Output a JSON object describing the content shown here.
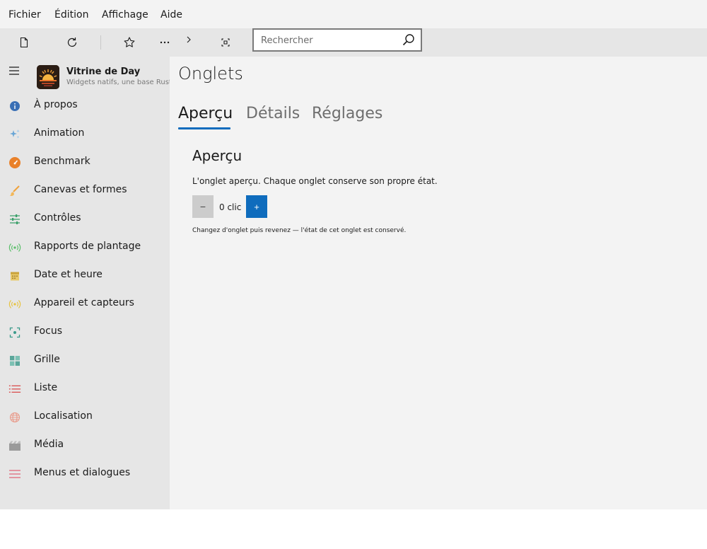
{
  "menubar": {
    "items": [
      "Fichier",
      "Édition",
      "Affichage",
      "Aide"
    ]
  },
  "toolbar": {
    "buttons": [
      "new-file-icon",
      "refresh-icon",
      "star-icon",
      "more-icon",
      "chevron-right-icon",
      "expand-icon"
    ],
    "search_placeholder": "Rechercher"
  },
  "sidebar": {
    "app_title": "Vitrine de Day",
    "app_subtitle": "Widgets natifs, une base Rust",
    "items": [
      {
        "label": "À propos",
        "icon": "info-icon",
        "color": "#3a6fb5"
      },
      {
        "label": "Animation",
        "icon": "sparkle-icon",
        "color": "#6aa6d6"
      },
      {
        "label": "Benchmark",
        "icon": "speedometer-icon",
        "color": "#e9812a"
      },
      {
        "label": "Canevas et formes",
        "icon": "brush-icon",
        "color": "#f0a33c"
      },
      {
        "label": "Contrôles",
        "icon": "sliders-icon",
        "color": "#3aa06a"
      },
      {
        "label": "Rapports de plantage",
        "icon": "broadcast-icon",
        "color": "#5bbf6a"
      },
      {
        "label": "Date et heure",
        "icon": "calendar-icon",
        "color": "#c9a23a"
      },
      {
        "label": "Appareil et capteurs",
        "icon": "sensor-icon",
        "color": "#e7c341"
      },
      {
        "label": "Focus",
        "icon": "focus-icon",
        "color": "#3a9a8a"
      },
      {
        "label": "Grille",
        "icon": "grid-icon",
        "color": "#5aa69a"
      },
      {
        "label": "Liste",
        "icon": "list-icon",
        "color": "#d94b4b"
      },
      {
        "label": "Localisation",
        "icon": "globe-icon",
        "color": "#e99a8a"
      },
      {
        "label": "Média",
        "icon": "film-icon",
        "color": "#9a9a9a"
      },
      {
        "label": "Menus et dialogues",
        "icon": "menu-lines-icon",
        "color": "#e07a8a"
      }
    ]
  },
  "main": {
    "page_title": "Onglets",
    "tabs": [
      {
        "label": "Aperçu",
        "active": true
      },
      {
        "label": "Détails",
        "active": false
      },
      {
        "label": "Réglages",
        "active": false
      }
    ],
    "section_title": "Aperçu",
    "section_desc": "L'onglet aperçu. Chaque onglet conserve son propre état.",
    "minus_label": "−",
    "plus_label": "+",
    "count_text": "0 clic",
    "hint": "Changez d'onglet puis revenez — l'état de cet onglet est conservé."
  },
  "colors": {
    "accent": "#0f6cbd"
  }
}
